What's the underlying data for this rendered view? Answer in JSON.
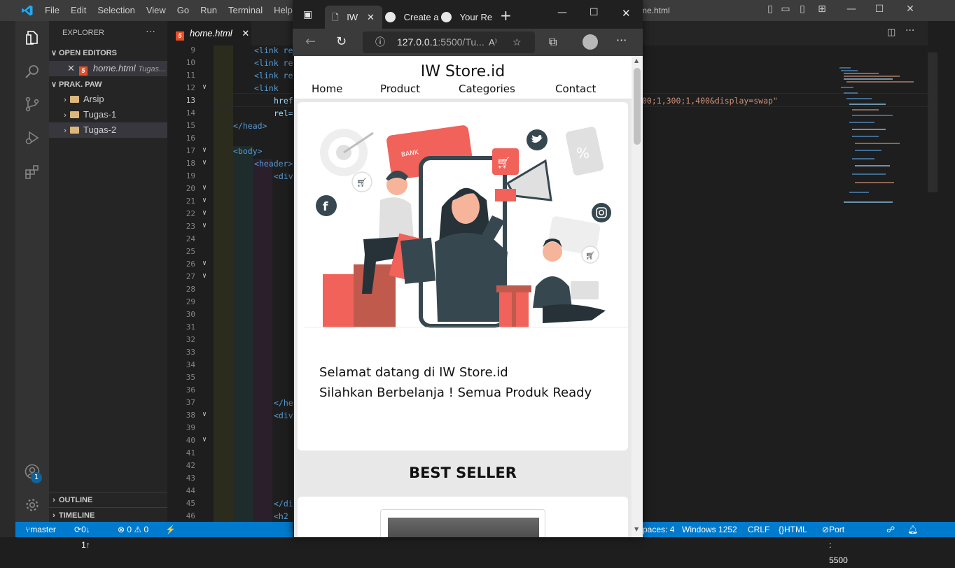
{
  "vscode": {
    "menu": [
      "File",
      "Edit",
      "Selection",
      "View",
      "Go",
      "Run",
      "Terminal",
      "Help"
    ],
    "window_title_fragment": "me.html",
    "explorer_title": "EXPLORER",
    "open_editors": "OPEN EDITORS",
    "open_file": "home.html",
    "open_file_dir": "Tugas...",
    "workspace": "PRAK. PAW",
    "folders": [
      "Arsip",
      "Tugas-1",
      "Tugas-2"
    ],
    "outline": "OUTLINE",
    "timeline": "TIMELINE",
    "tab_label": "home.html",
    "account_badge": "1",
    "line_numbers": [
      "9",
      "10",
      "11",
      "12",
      "13",
      "14",
      "15",
      "16",
      "17",
      "18",
      "19",
      "20",
      "21",
      "22",
      "23",
      "24",
      "25",
      "26",
      "27",
      "28",
      "29",
      "30",
      "31",
      "32",
      "33",
      "34",
      "35",
      "36",
      "37",
      "38",
      "39",
      "40",
      "41",
      "42",
      "43",
      "44",
      "45",
      "46"
    ],
    "code": {
      "l9": "<link re",
      "l10": "<link re",
      "l11": "<link re",
      "l12": "<link",
      "l13": "href",
      "l14": "rel=",
      "l15": "</head>",
      "l17": "<body>",
      "l18": "<header>",
      "l19": "<div",
      "l37": "</he",
      "l38": "<div",
      "l45": "</di",
      "l46": "<h2",
      "l13_tail": "00;1,300;1,400&display=swap\""
    },
    "status": {
      "branch": "master",
      "sync": "0↓ 1↑",
      "problems": "⊗ 0 ⚠ 0",
      "spaces": "paces: 4",
      "encoding": "Windows 1252",
      "eol": "CRLF",
      "language": "HTML",
      "port": "Port : 5500"
    }
  },
  "browser": {
    "tabs": [
      "IW",
      "Create a",
      "Your Re"
    ],
    "url_host": "127.0.0.1",
    "url_rest": ":5500/Tu...",
    "site": {
      "brand": "IW Store.id",
      "nav": [
        "Home",
        "Product",
        "Categories",
        "Contact"
      ],
      "welcome_line1": "Selamat datang di IW Store.id",
      "welcome_line2": "Silahkan Berbelanja ! Semua Produk Ready",
      "best_seller": "BEST SELLER",
      "bank_card_text": "BANK"
    }
  },
  "colors": {
    "accent": "#007acc",
    "brand_red": "#f0625a",
    "teal": "#37474f"
  }
}
